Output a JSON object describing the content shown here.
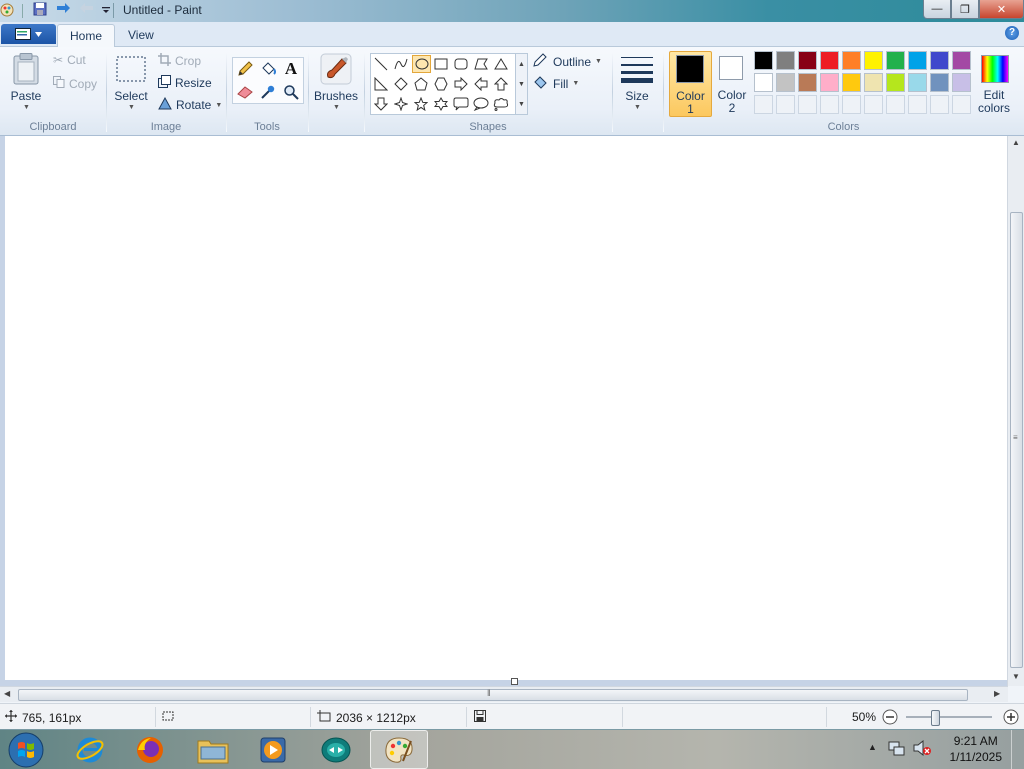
{
  "window": {
    "title": "Untitled - Paint"
  },
  "tabs": [
    {
      "label": "Home"
    },
    {
      "label": "View"
    }
  ],
  "ribbon": {
    "clipboard": {
      "label": "Clipboard",
      "paste": "Paste",
      "cut": "Cut",
      "copy": "Copy"
    },
    "image": {
      "label": "Image",
      "select": "Select",
      "crop": "Crop",
      "resize": "Resize",
      "rotate": "Rotate"
    },
    "tools": {
      "label": "Tools",
      "text_tool_glyph": "A"
    },
    "brushes": {
      "label": "Brushes"
    },
    "shapes": {
      "label": "Shapes",
      "outline": "Outline",
      "fill": "Fill"
    },
    "size": {
      "label": "Size"
    },
    "colors": {
      "label": "Colors",
      "color1_label": "Color",
      "color1_num": "1",
      "color2_label": "Color",
      "color2_num": "2",
      "edit_label": "Edit",
      "edit_label2": "colors",
      "color1_value": "#000000",
      "color2_value": "#ffffff",
      "palette_row1": [
        "#000000",
        "#7f7f7f",
        "#880015",
        "#ed1c24",
        "#ff7f27",
        "#fff200",
        "#22b14c",
        "#00a2e8",
        "#3f48cc",
        "#a349a4"
      ],
      "palette_row2": [
        "#ffffff",
        "#c3c3c3",
        "#b97a57",
        "#ffaec9",
        "#ffc90e",
        "#efe4b0",
        "#b5e61d",
        "#99d9ea",
        "#7092be",
        "#c8bfe7"
      ]
    }
  },
  "status": {
    "cursor_pos": "765, 161px",
    "image_size": "2036 × 1212px",
    "zoom": "50%",
    "zoom_level": 0.5
  },
  "taskbar": {
    "apps": [
      "start",
      "internet-explorer",
      "firefox",
      "file-explorer",
      "media-player",
      "teamviewer",
      "paint"
    ],
    "time": "9:21 AM",
    "date": "1/11/2025"
  }
}
